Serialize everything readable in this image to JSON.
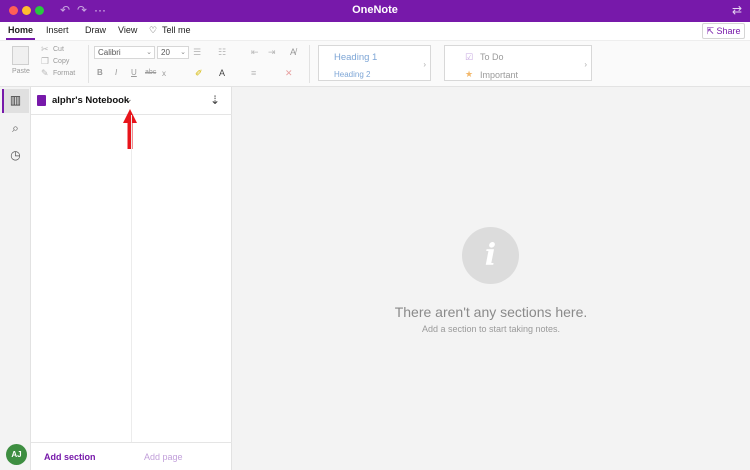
{
  "app": {
    "title": "OneNote"
  },
  "ribbon_tabs": [
    "Home",
    "Insert",
    "Draw",
    "View",
    "Tell me"
  ],
  "share_label": "Share",
  "ribbon": {
    "paste": "Paste",
    "cut": "Cut",
    "copy": "Copy",
    "format": "Format",
    "font_name": "Calibri",
    "font_size": "20",
    "bold": "B",
    "italic": "I",
    "underline": "U",
    "strike": "abc",
    "subscript": "x",
    "heading1": "Heading 1",
    "heading2": "Heading 2",
    "todo": "To Do",
    "important": "Important"
  },
  "notebook": {
    "title": "alphr's Notebook",
    "add_section": "Add section",
    "add_page": "Add page"
  },
  "user": {
    "initials": "AJ"
  },
  "empty_state": {
    "title": "There aren't any sections here.",
    "subtitle": "Add a section to start taking notes."
  },
  "icons": {
    "info": "i",
    "notebooks": "notebooks-icon",
    "search": "search-icon",
    "recent": "clock-icon"
  },
  "colors": {
    "accent": "#7719aa",
    "arrow": "#e8141b",
    "avatar": "#3e8e41"
  }
}
